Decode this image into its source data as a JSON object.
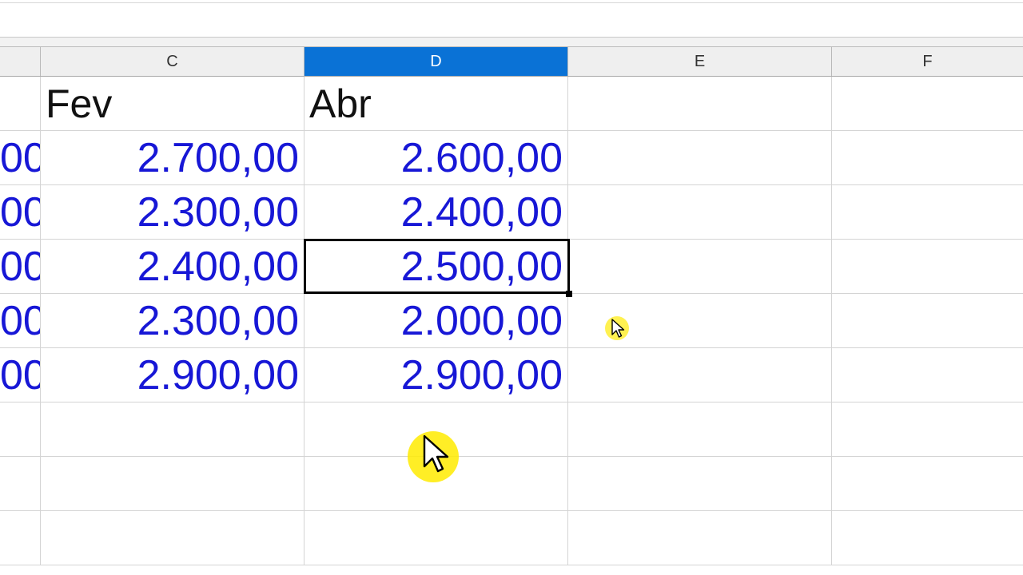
{
  "columns": [
    {
      "letter": "",
      "selected": false
    },
    {
      "letter": "C",
      "selected": false
    },
    {
      "letter": "D",
      "selected": true
    },
    {
      "letter": "E",
      "selected": false
    },
    {
      "letter": "F",
      "selected": false
    }
  ],
  "header_row": {
    "c": "Fev",
    "d": "Abr"
  },
  "rows": [
    {
      "b": "00",
      "c": "2.700,00",
      "d": "2.600,00"
    },
    {
      "b": "00",
      "c": "2.300,00",
      "d": "2.400,00"
    },
    {
      "b": "00",
      "c": "2.400,00",
      "d": "2.500,00"
    },
    {
      "b": "00",
      "c": "2.300,00",
      "d": "2.000,00"
    },
    {
      "b": "00",
      "c": "2.900,00",
      "d": "2.900,00"
    }
  ],
  "colors": {
    "selected_header": "#0a72d6",
    "number_text": "#1717d6",
    "pointer_highlight": "#ffeb00"
  },
  "icons": {
    "mouse_pointer": "mouse-pointer-icon",
    "small_pointer": "mouse-pointer-small-icon"
  }
}
